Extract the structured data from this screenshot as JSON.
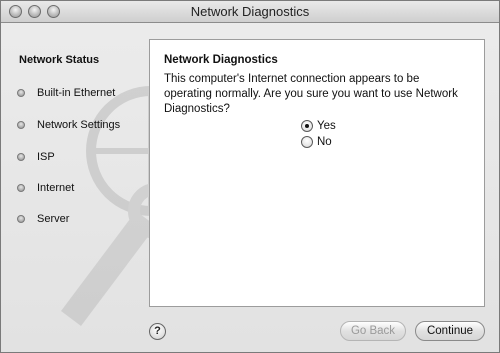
{
  "window": {
    "title": "Network Diagnostics"
  },
  "sidebar": {
    "heading": "Network Status",
    "items": [
      {
        "label": "Built-in Ethernet"
      },
      {
        "label": "Network Settings"
      },
      {
        "label": "ISP"
      },
      {
        "label": "Internet"
      },
      {
        "label": "Server"
      }
    ]
  },
  "panel": {
    "title": "Network Diagnostics",
    "message": "This computer's Internet connection appears to be operating normally. Are you sure you want to use Network Diagnostics?",
    "options": [
      {
        "label": "Yes",
        "selected": true
      },
      {
        "label": "No",
        "selected": false
      }
    ]
  },
  "footer": {
    "help_label": "?",
    "go_back_label": "Go Back",
    "continue_label": "Continue"
  }
}
